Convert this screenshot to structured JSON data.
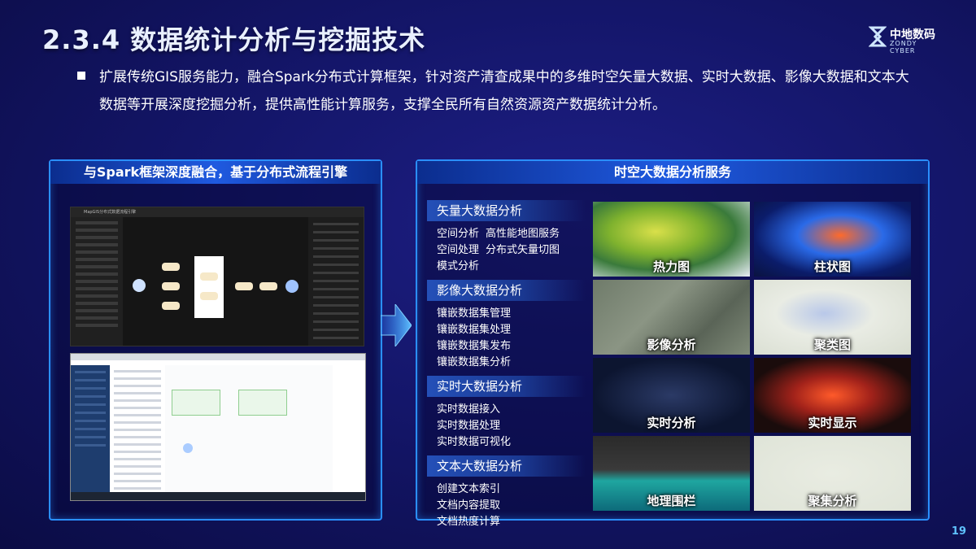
{
  "title": "2.3.4 数据统计分析与挖掘技术",
  "logo": {
    "name": "中地数码",
    "sub": "ZONDY CYBER"
  },
  "intro": "扩展传统GIS服务能力，融合Spark分布式计算框架，针对资产清查成果中的多维时空矢量大数据、实时大数据、影像大数据和文本大数据等开展深度挖掘分析，提供高性能计算服务，支撑全民所有自然资源资产数据统计分析。",
  "left_panel": {
    "header": "与Spark框架深度融合，基于分布式流程引擎",
    "screenshot1_title": "MapGIS分布式数据流程引擎",
    "screenshot2_title": "MapGIS数门"
  },
  "right_panel": {
    "header": "时空大数据分析服务",
    "categories": [
      {
        "label": "矢量大数据分析",
        "rows": [
          [
            "空间分析",
            "高性能地图服务"
          ],
          [
            "空间处理",
            "分布式矢量切图"
          ],
          [
            "模式分析"
          ]
        ]
      },
      {
        "label": "影像大数据分析",
        "rows": [
          [
            "镶嵌数据集管理",
            "镶嵌数据集处理"
          ],
          [
            "镶嵌数据集发布",
            "镶嵌数据集分析"
          ]
        ]
      },
      {
        "label": "实时大数据分析",
        "rows": [
          [
            "实时数据接入"
          ],
          [
            "实时数据处理"
          ],
          [
            "实时数据可视化"
          ]
        ]
      },
      {
        "label": "文本大数据分析",
        "rows": [
          [
            "创建文本索引"
          ],
          [
            "文档内容提取"
          ],
          [
            "文档热度计算"
          ]
        ]
      }
    ],
    "tiles": [
      "热力图",
      "柱状图",
      "影像分析",
      "聚类图",
      "实时分析",
      "实时显示",
      "地理围栏",
      "聚集分析"
    ]
  },
  "page_number": "19",
  "colors": {
    "accent": "#2a8fff",
    "header_blue": "#1f5ae0",
    "background": "#14166a"
  }
}
